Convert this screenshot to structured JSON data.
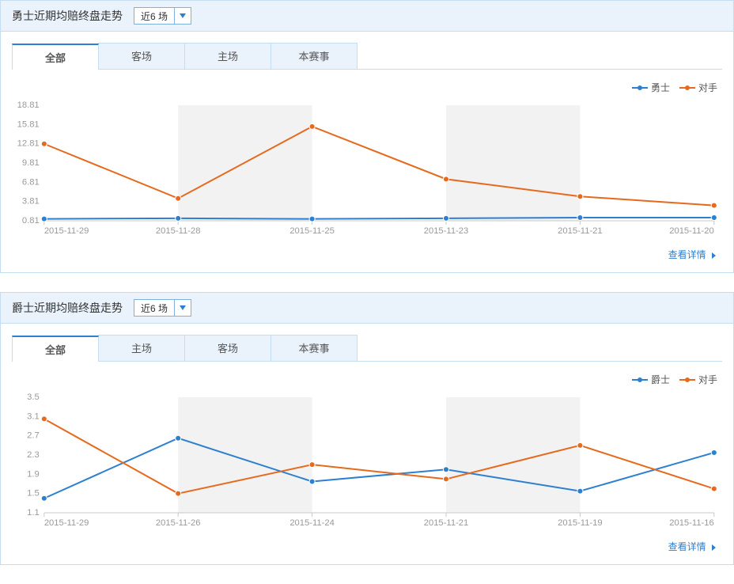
{
  "colors": {
    "series_primary": "#2d7fcf",
    "series_opponent": "#e56a1e"
  },
  "common": {
    "select_label": "近6 场",
    "details_label": "查看详情",
    "legend_opponent": "对手"
  },
  "panels": [
    {
      "title": "勇士近期均赔终盘走势",
      "legend_primary": "勇士",
      "tabs": [
        "全部",
        "客场",
        "主场",
        "本赛事"
      ],
      "active_tab": 0
    },
    {
      "title": "爵士近期均赔终盘走势",
      "legend_primary": "爵士",
      "tabs": [
        "全部",
        "主场",
        "客场",
        "本赛事"
      ],
      "active_tab": 0
    }
  ],
  "chart_data": [
    {
      "type": "line",
      "title": "勇士近期均赔终盘走势",
      "xlabel": "",
      "ylabel": "",
      "ylim": [
        0.81,
        18.81
      ],
      "y_ticks": [
        0.81,
        3.81,
        6.81,
        9.81,
        12.81,
        15.81,
        18.81
      ],
      "categories": [
        "2015-11-29",
        "2015-11-28",
        "2015-11-25",
        "2015-11-23",
        "2015-11-21",
        "2015-11-20"
      ],
      "series": [
        {
          "name": "勇士",
          "color": "#2d7fcf",
          "values": [
            1.1,
            1.2,
            1.1,
            1.2,
            1.3,
            1.3
          ]
        },
        {
          "name": "对手",
          "color": "#e56a1e",
          "values": [
            12.8,
            4.3,
            15.5,
            7.3,
            4.6,
            3.2
          ]
        }
      ]
    },
    {
      "type": "line",
      "title": "爵士近期均赔终盘走势",
      "xlabel": "",
      "ylabel": "",
      "ylim": [
        1.1,
        3.5
      ],
      "y_ticks": [
        1.1,
        1.5,
        1.9,
        2.3,
        2.7,
        3.1,
        3.5
      ],
      "categories": [
        "2015-11-29",
        "2015-11-26",
        "2015-11-24",
        "2015-11-21",
        "2015-11-19",
        "2015-11-16"
      ],
      "series": [
        {
          "name": "爵士",
          "color": "#2d7fcf",
          "values": [
            1.4,
            2.65,
            1.75,
            2.0,
            1.55,
            2.35
          ]
        },
        {
          "name": "对手",
          "color": "#e56a1e",
          "values": [
            3.05,
            1.5,
            2.1,
            1.8,
            2.5,
            1.6
          ]
        }
      ]
    }
  ]
}
